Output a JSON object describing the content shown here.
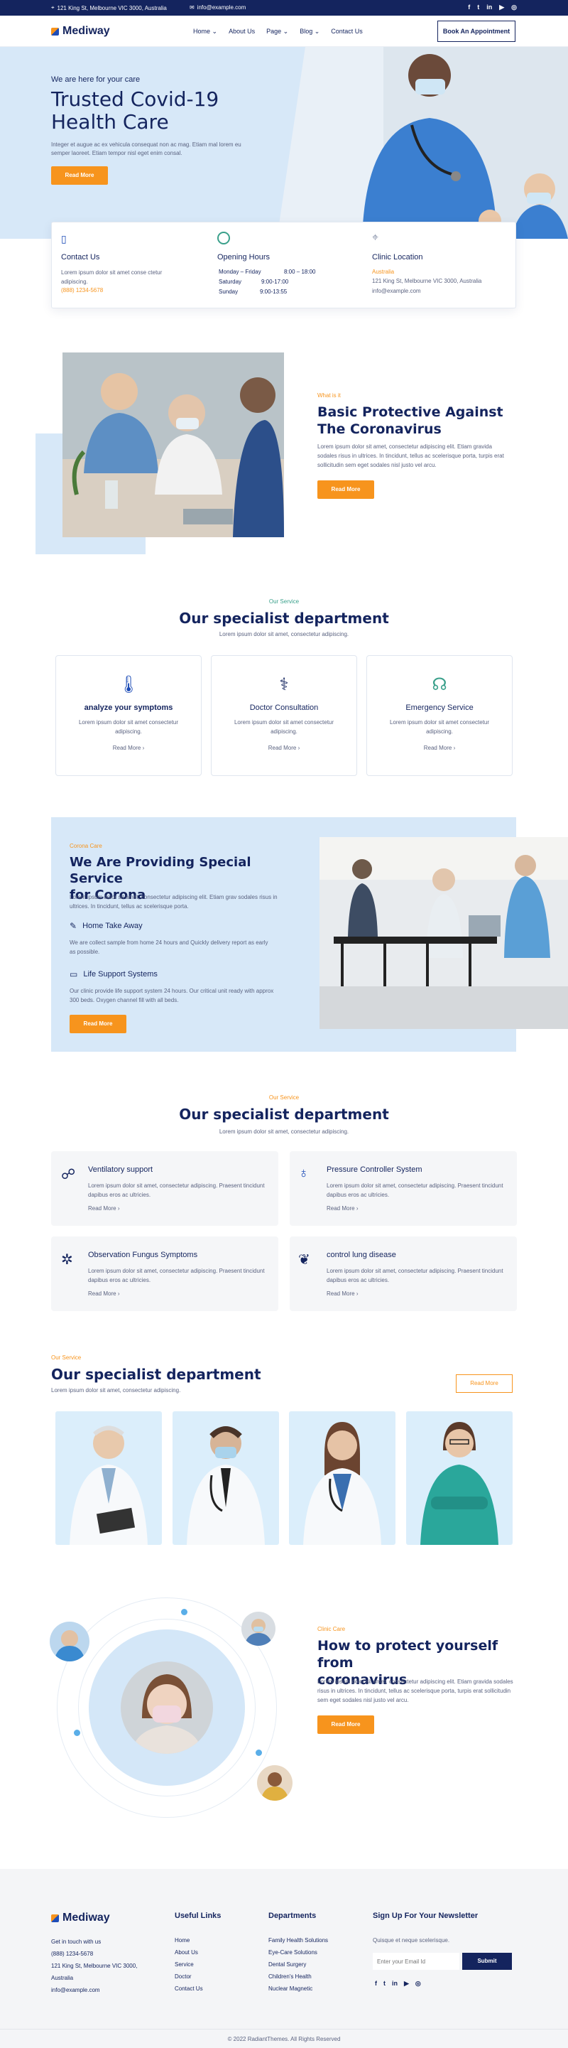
{
  "topbar": {
    "address": "121 King St, Melbourne VIC 3000, Australia",
    "email": "info@example.com",
    "social": [
      "f",
      "t",
      "in",
      "▶",
      "◎"
    ]
  },
  "header": {
    "logo": "Mediway",
    "menu": [
      "Home",
      "About Us",
      "Page",
      "Blog",
      "Contact Us"
    ],
    "cta": "Book An Appointment"
  },
  "hero": {
    "kicker": "We are here for your care",
    "title_line1": "Trusted Covid-19",
    "title_line2": "Health Care",
    "text": "Integer et augue ac ex vehicula consequat non ac mag. Etiam mal lorem eu semper laoreet. Etiam tempor nisl eget enim consal.",
    "button": "Read More"
  },
  "info": {
    "contact_title": "Contact Us",
    "contact_text": "Lorem ipsum dolor sit amet conse ctetur adipiscing.",
    "contact_phone": "(888) 1234-5678",
    "hours_title": "Opening Hours",
    "hours": [
      {
        "day": "Monday – Friday",
        "time": "8:00 – 18:00"
      },
      {
        "day": "Saturday",
        "time": "9:00-17:00"
      },
      {
        "day": "Sunday",
        "time": "9:00-13:55"
      }
    ],
    "location_title": "Clinic Location",
    "location_city": "Australia",
    "location_address": "121 King St, Melbourne VIC 3000, Australia",
    "location_email": "info@example.com"
  },
  "protective": {
    "kicker": "What is it",
    "title": "Basic Protective Against The Coronavirus",
    "text": "Lorem ipsum dolor sit amet, consectetur adipiscing elit. Etiam gravida sodales risus in ultrices. In tincidunt, tellus ac scelerisque porta, turpis erat sollicitudin sem eget sodales nisl justo vel arcu.",
    "button": "Read More"
  },
  "specialist1": {
    "kicker": "Our Service",
    "title": "Our specialist department",
    "subtitle": "Lorem ipsum dolor sit amet, consectetur adipiscing.",
    "cards": [
      {
        "title": "analyze your symptoms",
        "text": "Lorem ipsum dolor sit amet consectetur adipiscing.",
        "link": "Read More",
        "icon": "thermometer-icon"
      },
      {
        "title": "Doctor Consultation",
        "text": "Lorem ipsum dolor sit amet consectetur adipiscing.",
        "link": "Read More",
        "icon": "stethoscope-icon"
      },
      {
        "title": "Emergency Service",
        "text": "Lorem ipsum dolor sit amet consectetur adipiscing.",
        "link": "Read More",
        "icon": "headset-icon"
      }
    ]
  },
  "special": {
    "kicker": "Corona Care",
    "title_line1": "We Are Providing Special Service",
    "title_line2": "for Corona",
    "text": "Lorem ipsum dolor sit amet, consectetur adipiscing elit. Etiam grav sodales risus in ultrices. In tincidunt, tellus ac scelerisque porta.",
    "items": [
      {
        "title": "Home Take Away",
        "text": "We are collect sample from home 24 hours and Quickly delivery report as early as possible."
      },
      {
        "title": "Life Support Systems",
        "text": "Our clinic provide life support system 24 hours. Our critical unit ready with approx 300 beds. Oxygen channel fill with all beds."
      }
    ],
    "button": "Read More"
  },
  "specialist2": {
    "kicker": "Our Service",
    "title": "Our specialist department",
    "subtitle": "Lorem ipsum dolor sit amet, consectetur adipiscing.",
    "cards": [
      {
        "title": "Ventilatory support",
        "text": "Lorem ipsum dolor sit amet, consectetur adipiscing. Praesent tincidunt dapibus eros ac ultricies.",
        "link": "Read More"
      },
      {
        "title": "Pressure Controller System",
        "text": "Lorem ipsum dolor sit amet, consectetur adipiscing. Praesent tincidunt dapibus eros ac ultricies.",
        "link": "Read More"
      },
      {
        "title": "Observation Fungus Symptoms",
        "text": "Lorem ipsum dolor sit amet, consectetur adipiscing. Praesent tincidunt dapibus eros ac ultricies.",
        "link": "Read More"
      },
      {
        "title": "control lung disease",
        "text": "Lorem ipsum dolor sit amet, consectetur adipiscing. Praesent tincidunt dapibus eros ac ultricies.",
        "link": "Read More"
      }
    ]
  },
  "team": {
    "kicker": "Our Service",
    "title": "Our specialist department",
    "subtitle": "Lorem ipsum dolor sit amet, consectetur adipiscing.",
    "button": "Read More"
  },
  "protect": {
    "kicker": "Clinic Care",
    "title_line1": "How to protect yourself from",
    "title_line2": "coronavirus",
    "text": "Lorem ipsum dolor sit amet, consectetur adipiscing elit. Etiam gravida sodales risus in ultrices. In tincidunt, tellus ac scelerisque porta, turpis erat sollicitudin sem eget sodales nisl justo vel arcu.",
    "button": "Read More"
  },
  "footer": {
    "logo": "Mediway",
    "touch": "Get in touch with us",
    "phone": "(888) 1234-5678",
    "address": "121 King St, Melbourne VIC 3000, Australia",
    "email": "info@example.com",
    "useful_title": "Useful Links",
    "useful": [
      "Home",
      "About Us",
      "Service",
      "Doctor",
      "Contact Us"
    ],
    "dept_title": "Departments",
    "depts": [
      "Family Health Solutions",
      "Eye-Care Solutions",
      "Dental Surgery",
      "Children's Health",
      "Nuclear Magnetic"
    ],
    "news_title": "Sign Up For Your Newsletter",
    "news_text": "Quisque et neque scelerisque.",
    "news_placeholder": "Enter your Email Id",
    "news_button": "Submit",
    "copyright": "© 2022 RadiantThemes. All Rights Reserved"
  },
  "colors": {
    "navy": "#14245e",
    "orange": "#f7941d",
    "light_blue": "#d7e8f8"
  }
}
